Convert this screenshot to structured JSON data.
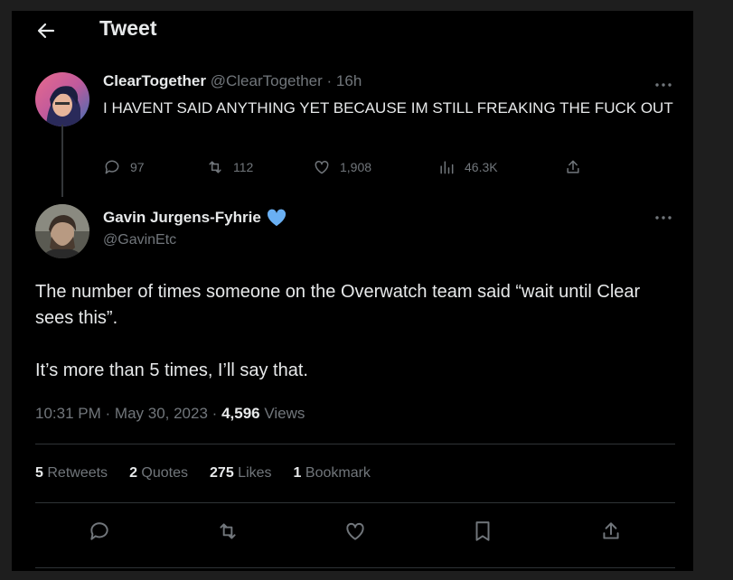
{
  "header": {
    "title": "Tweet",
    "back_icon": "arrow-left-icon"
  },
  "parent_tweet": {
    "display_name": "ClearTogether",
    "handle": "@ClearTogether",
    "separator": "·",
    "time": "16h",
    "text": "I HAVENT SAID ANYTHING YET BECAUSE IM STILL FREAKING THE FUCK OUT",
    "actions": {
      "replies": "97",
      "retweets": "112",
      "likes": "1,908",
      "views": "46.3K"
    }
  },
  "main_tweet": {
    "display_name": "Gavin Jurgens-Fyhrie",
    "verified_color": "#6ab0f3",
    "handle": "@GavinEtc",
    "body_line1": "The number of times someone on the Overwatch  team said “wait until Clear sees this”.",
    "body_line2": "It’s more than 5 times, I’ll say that.",
    "time": "10:31 PM",
    "date": "May 30, 2023",
    "separator": "·",
    "views_count": "4,596",
    "views_label": "Views",
    "stats": {
      "retweets_count": "5",
      "retweets_label": "Retweets",
      "quotes_count": "2",
      "quotes_label": "Quotes",
      "likes_count": "275",
      "likes_label": "Likes",
      "bookmarks_count": "1",
      "bookmarks_label": "Bookmark"
    }
  },
  "colors": {
    "background": "#000000",
    "text": "#e7e9ea",
    "muted": "#71767b",
    "divider": "#2f3336"
  }
}
